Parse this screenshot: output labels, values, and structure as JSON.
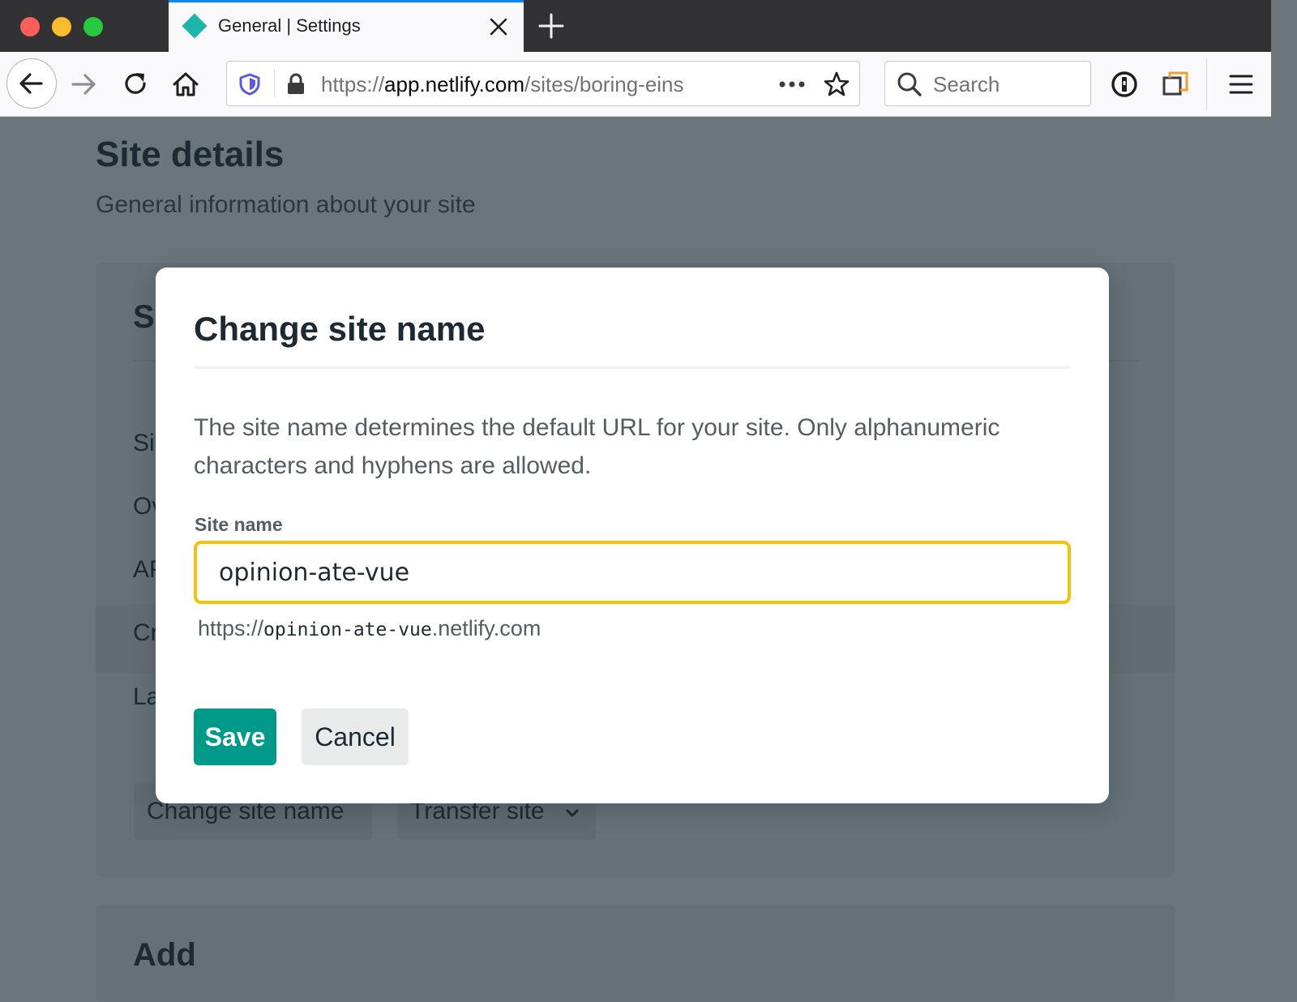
{
  "browser": {
    "tab_title": "General | Settings",
    "url": {
      "prefix": "https://",
      "host": "app.netlify.com",
      "path": "/sites/boring-eins"
    },
    "search_placeholder": "Search",
    "colors": {
      "tab_accent": "#0a84ff",
      "favicon": "#1fb5a8"
    }
  },
  "page": {
    "title": "Site details",
    "subtitle": "General information about your site",
    "card": {
      "heading_partial": "S",
      "row_partials": [
        "Si",
        "Ov",
        "AP",
        "Cr",
        "La"
      ],
      "buttons": {
        "change_site_name": "Change site name",
        "transfer_site": "Transfer site"
      }
    },
    "card2_heading_partial": "Add"
  },
  "modal": {
    "title": "Change site name",
    "description": "The site name determines the default URL for your site. Only alphanumeric characters and hyphens are allowed.",
    "field_label": "Site name",
    "field_value": "opinion-ate-vue",
    "preview": {
      "prefix": "https://",
      "name": "opinion-ate-vue",
      "suffix": ".netlify.com"
    },
    "save_label": "Save",
    "cancel_label": "Cancel",
    "colors": {
      "save_bg": "#00998a",
      "input_focus_border": "#f4c20d"
    }
  }
}
